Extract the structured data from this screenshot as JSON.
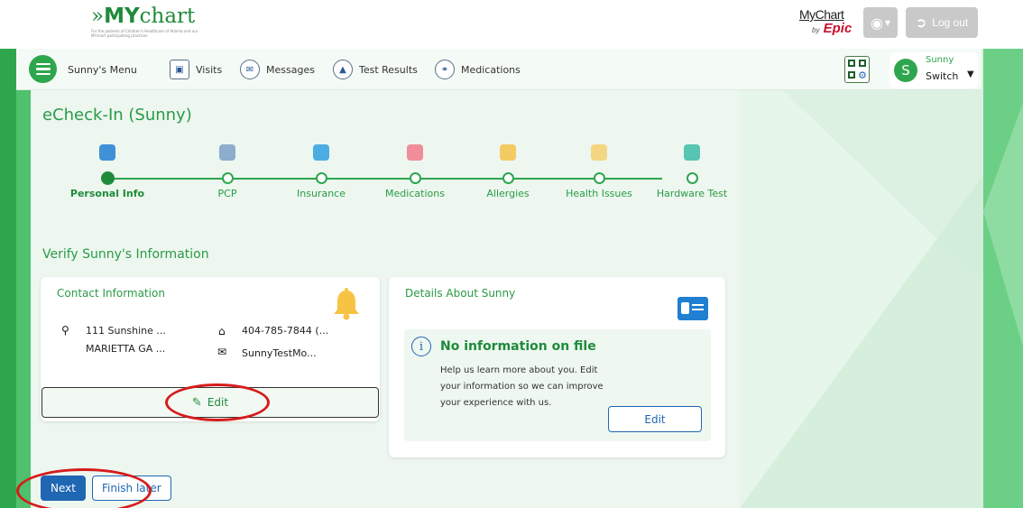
{
  "header": {
    "brand_prefix": "»",
    "brand_bold": "MY",
    "brand_rest": "chart",
    "brand_tagline": "For the patients of Children's Healthcare of Atlanta and our MYchart participating practices",
    "epic_line1": "MyChart",
    "epic_by": "by",
    "epic_line2": "Epic",
    "lang_icon": "globe-icon",
    "logout_label": "Log out"
  },
  "nav": {
    "menu_label": "Sunny's Menu",
    "items": [
      {
        "label": "Visits",
        "icon": "calendar-icon"
      },
      {
        "label": "Messages",
        "icon": "envelope-icon"
      },
      {
        "label": "Test Results",
        "icon": "flask-icon"
      },
      {
        "label": "Medications",
        "icon": "pills-icon"
      }
    ],
    "switch_name": "Sunny",
    "switch_initial": "S",
    "switch_label": "Switch"
  },
  "page": {
    "title": "eCheck-In (Sunny)",
    "verify_title": "Verify Sunny's Information",
    "steps": [
      {
        "label": "Personal Info",
        "icon": "id-card-icon",
        "color": "#1f7fd1",
        "current": true
      },
      {
        "label": "PCP",
        "icon": "stethoscope-icon",
        "color": "#7aa0c8",
        "current": false
      },
      {
        "label": "Insurance",
        "icon": "umbrella-icon",
        "color": "#2fa0e0",
        "current": false
      },
      {
        "label": "Medications",
        "icon": "pills-icon",
        "color": "#f07a8a",
        "current": false
      },
      {
        "label": "Allergies",
        "icon": "pollen-icon",
        "color": "#f5c24a",
        "current": false
      },
      {
        "label": "Health Issues",
        "icon": "bandage-icon",
        "color": "#f5d070",
        "current": false
      },
      {
        "label": "Hardware Test",
        "icon": "video-camera-icon",
        "color": "#3dbba8",
        "current": false
      }
    ]
  },
  "contact": {
    "title": "Contact Information",
    "address_line1": "111 Sunshine ...",
    "address_line2": "MARIETTA GA ...",
    "phone": "404-785-7844 (...",
    "email": "SunnyTestMo...",
    "edit_label": "Edit"
  },
  "details": {
    "title": "Details About Sunny",
    "noinfo_title": "No information on file",
    "noinfo_text": "Help us learn more about you. Edit your information so we can improve your experience with us.",
    "edit_label": "Edit"
  },
  "footer": {
    "next_label": "Next",
    "finish_label": "Finish later"
  },
  "colors": {
    "brand_green": "#2ea64d",
    "link_blue": "#1f66b3",
    "annotation_red": "#d61b1b"
  }
}
